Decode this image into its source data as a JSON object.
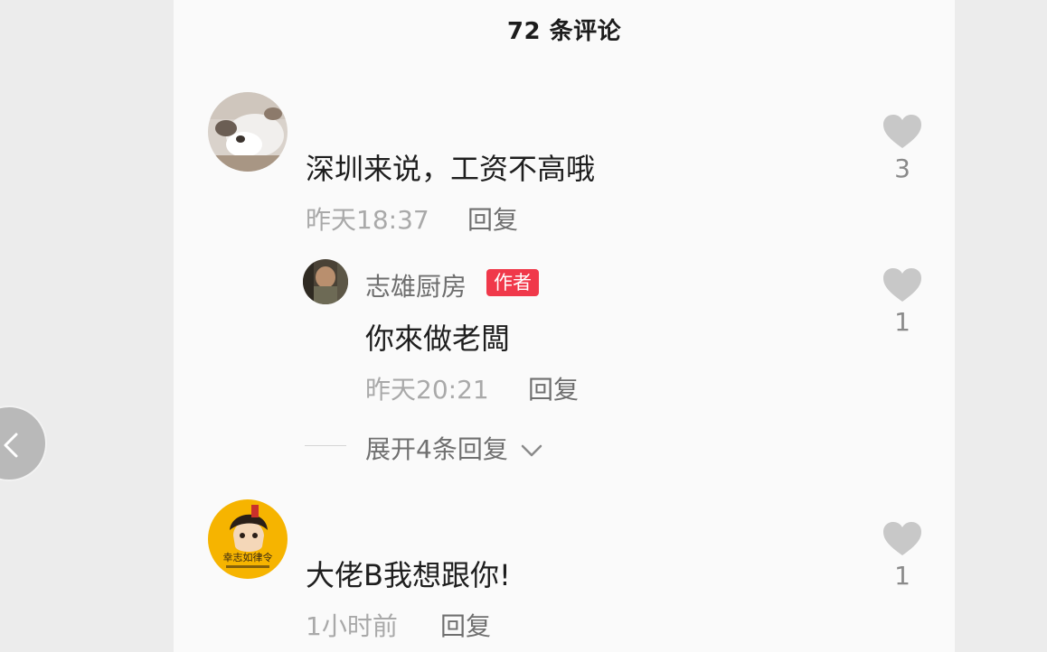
{
  "header": {
    "title": "72 条评论"
  },
  "comments": [
    {
      "text": "深圳来说，工资不高哦",
      "time": "昨天18:37",
      "reply_label": "回复",
      "likes": "3",
      "avatar_icon": "cat-photo-avatar"
    },
    {
      "author": "志雄厨房",
      "badge": "作者",
      "text": "你來做老闆",
      "time": "昨天20:21",
      "reply_label": "回复",
      "likes": "1",
      "avatar_icon": "chef-photo-avatar"
    },
    {
      "text": "大佬B我想跟你!",
      "time": "1小时前",
      "reply_label": "回复",
      "likes": "1",
      "avatar_icon": "cartoon-yellow-avatar",
      "avatar_logo_text": "幸志如律令"
    }
  ],
  "expand": {
    "label": "展开4条回复",
    "icon": "chevron-down-icon"
  },
  "colors": {
    "badge": "#f0384a",
    "heart": "#c8c8c8",
    "avatar_yellow": "#f6b400"
  }
}
